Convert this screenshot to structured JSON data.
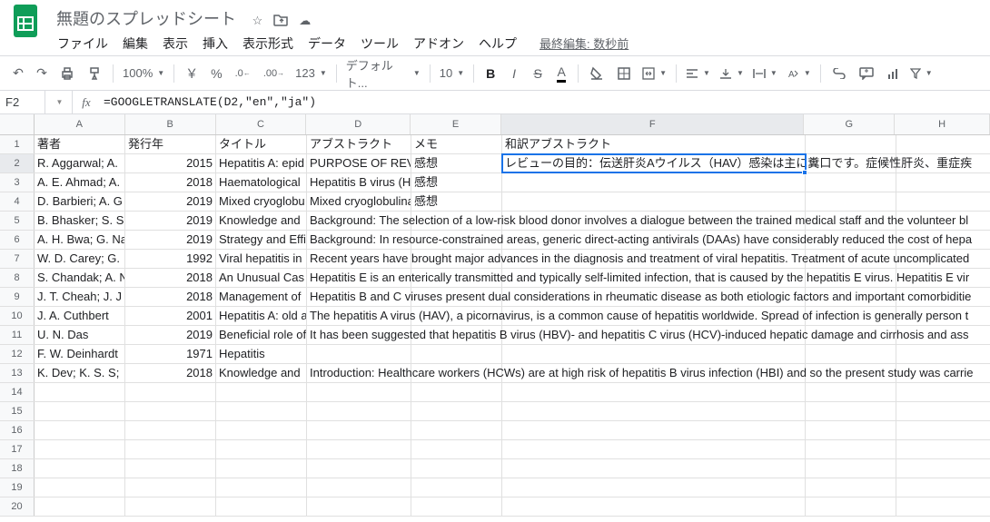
{
  "doc": {
    "title": "無題のスプレッドシート"
  },
  "menus": [
    "ファイル",
    "編集",
    "表示",
    "挿入",
    "表示形式",
    "データ",
    "ツール",
    "アドオン",
    "ヘルプ"
  ],
  "last_edit": "最終編集: 数秒前",
  "toolbar": {
    "zoom": "100%",
    "currency": "￥",
    "percent": "%",
    "dec_dec": ".0",
    "inc_dec": ".00",
    "numfmt": "123",
    "font": "デフォルト...",
    "size": "10",
    "bold": "B",
    "italic": "I",
    "strike": "S",
    "textcolor": "A"
  },
  "namebox": "F2",
  "formula": "=GOOGLETRANSLATE(D2,\"en\",\"ja\")",
  "cols": [
    "A",
    "B",
    "C",
    "D",
    "E",
    "F",
    "G",
    "H"
  ],
  "r1": {
    "A": "著者",
    "B": "発行年",
    "C": "タイトル",
    "D": "アブストラクト",
    "E": "メモ",
    "F": "和訳アブストラクト"
  },
  "r2": {
    "A": "R. Aggarwal; A.",
    "B": "2015",
    "C": "Hepatitis A: epid",
    "D": "PURPOSE OF REV",
    "E": "感想",
    "F": "レビューの目的：伝送肝炎Aウイルス（HAV）感染は主に糞口です。症候性肝炎、重症疾"
  },
  "r3": {
    "A": "A. E. Ahmad; A.",
    "B": "2018",
    "C": "Haematological",
    "D": "Hepatitis B virus (H",
    "E": "感想"
  },
  "r4": {
    "A": "D. Barbieri; A. G",
    "B": "2019",
    "C": "Mixed cryoglobu",
    "D": "Mixed cryoglobulina",
    "E": "感想"
  },
  "r5": {
    "A": "B. Bhasker; S. S",
    "B": "2019",
    "C": "Knowledge and",
    "D": "Background: The selection of a low-risk blood donor involves a dialogue between the trained medical staff and the volunteer bl"
  },
  "r6": {
    "A": "A. H. Bwa; G. Na",
    "B": "2019",
    "C": "Strategy and Effi",
    "D": "Background: In resource-constrained areas, generic direct-acting antivirals (DAAs) have considerably reduced the cost of hepa"
  },
  "r7": {
    "A": "W. D. Carey; G.",
    "B": "1992",
    "C": "Viral hepatitis in",
    "D": "Recent years have brought major advances in the diagnosis and treatment of viral hepatitis. Treatment of acute uncomplicated"
  },
  "r8": {
    "A": "S. Chandak; A. N",
    "B": "2018",
    "C": "An Unusual Cas",
    "D": "Hepatitis E is an enterically transmitted and typically self-limited infection, that is caused by the hepatitis E virus. Hepatitis E vir"
  },
  "r9": {
    "A": "J. T. Cheah; J. J",
    "B": "2018",
    "C": "Management of",
    "D": "Hepatitis B and C viruses present dual considerations in rheumatic disease as both etiologic factors and important comorbiditie"
  },
  "r10": {
    "A": "J. A. Cuthbert",
    "B": "2001",
    "C": "Hepatitis A: old a",
    "D": "The hepatitis A virus (HAV), a picornavirus, is a common cause of hepatitis worldwide. Spread of infection is generally person t"
  },
  "r11": {
    "A": "U. N. Das",
    "B": "2019",
    "C": "Beneficial role of",
    "D": "It has been suggested that hepatitis B virus (HBV)- and hepatitis C virus (HCV)-induced hepatic damage and cirrhosis and ass"
  },
  "r12": {
    "A": "F. W. Deinhardt",
    "B": "1971",
    "C": "Hepatitis"
  },
  "r13": {
    "A": "K. Dev; K. S. S;",
    "B": "2018",
    "C": "Knowledge and",
    "D": "Introduction: Healthcare workers (HCWs) are at high risk of hepatitis B virus infection (HBI) and so the present study was carrie"
  }
}
